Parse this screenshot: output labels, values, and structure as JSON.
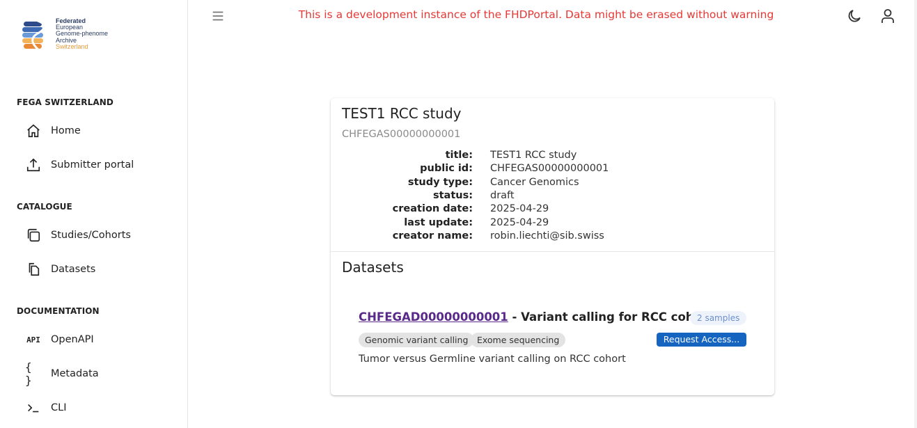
{
  "logo": {
    "lines": [
      "Federated",
      "European",
      "Genome-phenome",
      "Archive",
      "Switzerland"
    ]
  },
  "banner": "This is a development instance of the FHDPortal. Data might be erased without warning",
  "sidebar": {
    "sections": [
      {
        "title": "FEGA SWITZERLAND",
        "items": [
          {
            "label": "Home",
            "icon": "home-icon"
          },
          {
            "label": "Submitter portal",
            "icon": "upload-icon"
          }
        ]
      },
      {
        "title": "CATALOGUE",
        "items": [
          {
            "label": "Studies/Cohorts",
            "icon": "folders-icon"
          },
          {
            "label": "Datasets",
            "icon": "documents-icon"
          }
        ]
      },
      {
        "title": "DOCUMENTATION",
        "items": [
          {
            "label": "OpenAPI",
            "icon": "api-icon"
          },
          {
            "label": "Metadata",
            "icon": "braces-icon"
          },
          {
            "label": "CLI",
            "icon": "terminal-icon"
          }
        ]
      }
    ]
  },
  "api_icon_text": "API",
  "braces_icon_text": "{ }",
  "study": {
    "title": "TEST1 RCC study",
    "public_id": "CHFEGAS00000000001",
    "properties": [
      {
        "key": "title:",
        "value": "TEST1 RCC study"
      },
      {
        "key": "public id:",
        "value": "CHFEGAS00000000001"
      },
      {
        "key": "study type:",
        "value": "Cancer Genomics"
      },
      {
        "key": "status:",
        "value": "draft"
      },
      {
        "key": "creation date:",
        "value": "2025-04-29"
      },
      {
        "key": "last update:",
        "value": "2025-04-29"
      },
      {
        "key": "creator name:",
        "value": "robin.liechti@sib.swiss"
      }
    ]
  },
  "datasets": {
    "heading": "Datasets",
    "items": [
      {
        "id": "CHFEGAD00000000001",
        "title_suffix": " - Variant calling for RCC cohort",
        "samples": "2 samples",
        "tags": [
          "Genomic variant calling",
          "Exome sequencing"
        ],
        "request_label": "Request Access...",
        "description": "Tumor versus Germline variant calling on RCC cohort"
      }
    ]
  }
}
